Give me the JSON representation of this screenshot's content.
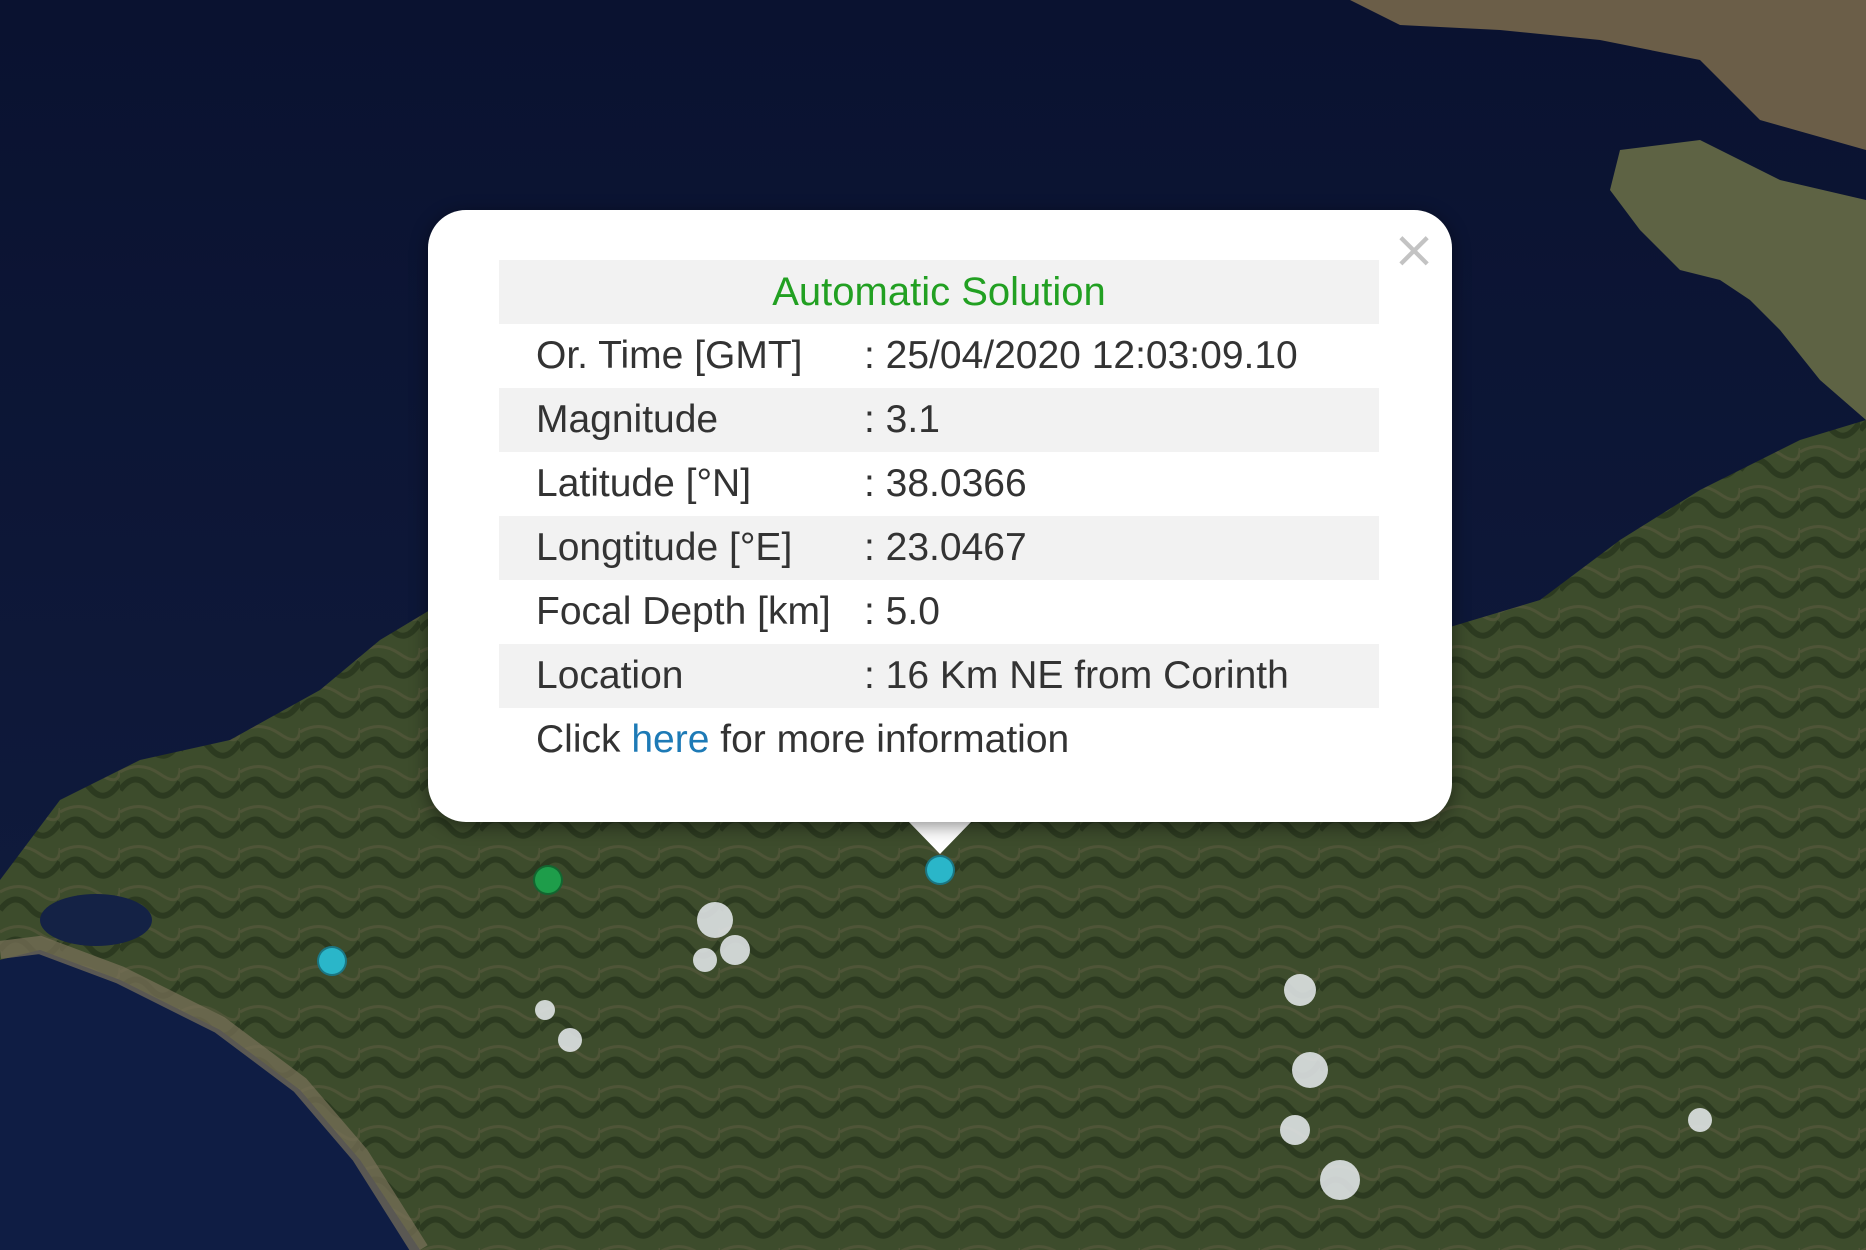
{
  "popup": {
    "title": "Automatic Solution",
    "close_label": "×",
    "rows": [
      {
        "label": "Or. Time [GMT]",
        "value": ": 25/04/2020 12:03:09.10"
      },
      {
        "label": "Magnitude",
        "value": ": 3.1"
      },
      {
        "label": "Latitude [°N]",
        "value": ": 38.0366"
      },
      {
        "label": "Longtitude [°E]",
        "value": ": 23.0467"
      },
      {
        "label": "Focal Depth [km]",
        "value": ": 5.0"
      },
      {
        "label": "Location",
        "value": ": 16 Km NE from Corinth"
      }
    ],
    "more_prefix": "Click ",
    "more_link": "here",
    "more_suffix": " for more information"
  },
  "markers": [
    {
      "name": "quake-marker-selected",
      "color": "#2ab6c9"
    },
    {
      "name": "quake-marker-green",
      "color": "#1e9d4a"
    },
    {
      "name": "quake-marker-cyan",
      "color": "#2ab6c9"
    }
  ],
  "colors": {
    "sea": "#0d1634",
    "land": "#3a4a2c",
    "title_green": "#22a022",
    "link_blue": "#1d7ab6"
  }
}
